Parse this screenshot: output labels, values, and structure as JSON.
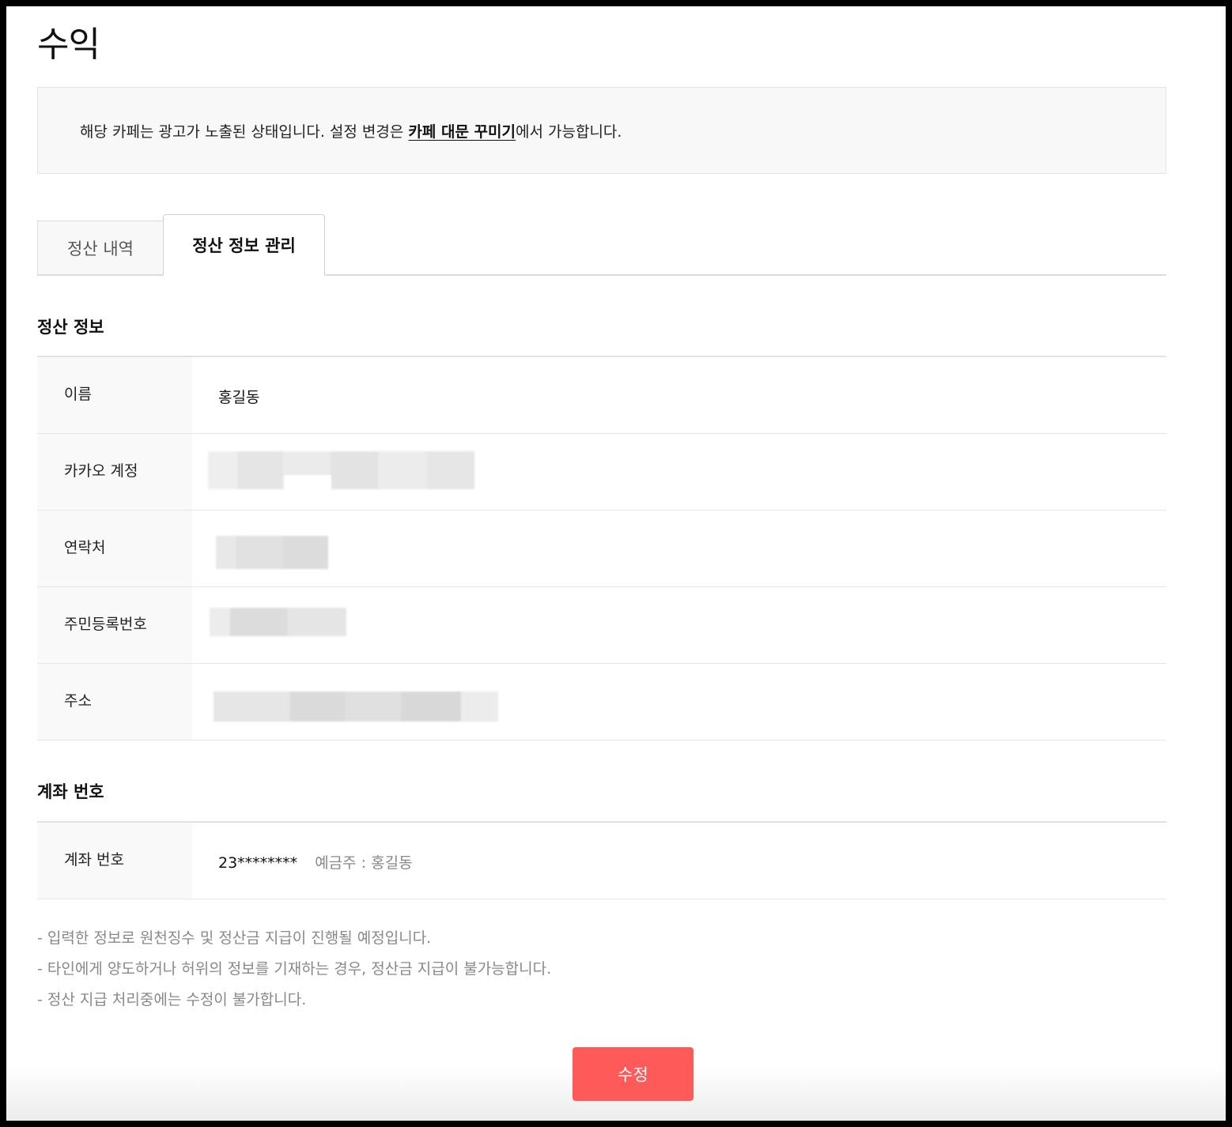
{
  "page": {
    "title": "수익"
  },
  "notice": {
    "text_before": "해당 카페는 광고가 노출된 상태입니다. 설정 변경은 ",
    "link": "카페 대문 꾸미기",
    "text_after": "에서 가능합니다."
  },
  "tabs": [
    {
      "label": "정산 내역",
      "active": false
    },
    {
      "label": "정산 정보 관리",
      "active": true
    }
  ],
  "settlement_info": {
    "title": "정산 정보",
    "rows": [
      {
        "label": "이름",
        "value": "홍길동"
      },
      {
        "label": "카카오 계정",
        "value": ""
      },
      {
        "label": "연락처",
        "value": ""
      },
      {
        "label": "주민등록번호",
        "value": ""
      },
      {
        "label": "주소",
        "value": ""
      }
    ]
  },
  "account": {
    "title": "계좌 번호",
    "label": "계좌 번호",
    "number": "23********",
    "holder": "예금주 : 홍길동"
  },
  "notes": [
    "- 입력한 정보로 원천징수 및 정산금 지급이 진행될 예정입니다.",
    "- 타인에게 양도하거나 허위의 정보를 기재하는 경우, 정산금 지급이 불가능합니다.",
    "- 정산 지급 처리중에는 수정이 불가합니다."
  ],
  "edit_button": {
    "label": "수정"
  },
  "colors": {
    "accent": "#ff5a5a",
    "muted_text": "#888888",
    "label_bg": "#f9f9f9"
  }
}
